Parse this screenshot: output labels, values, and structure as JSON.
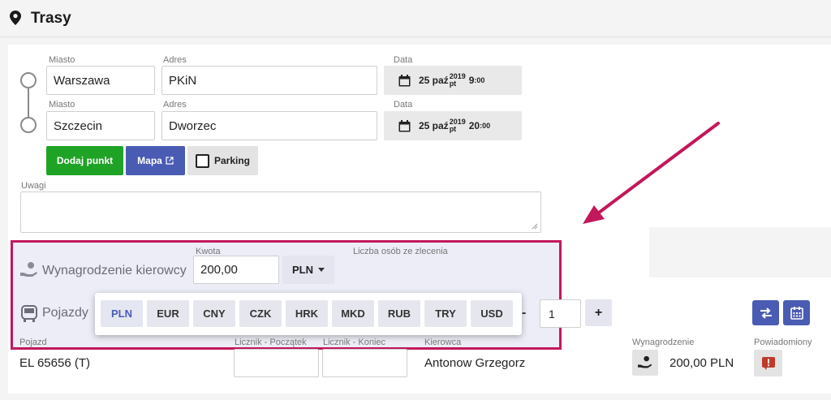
{
  "header": {
    "title": "Trasy"
  },
  "route": {
    "labels": {
      "city": "Miasto",
      "address": "Adres",
      "date": "Data"
    },
    "points": [
      {
        "city": "Warszawa",
        "address": "PKiN",
        "day": "25 paź",
        "year": "2019",
        "weekday": "pt",
        "hour": "9",
        "minutes": ":00"
      },
      {
        "city": "Szczecin",
        "address": "Dworzec",
        "day": "25 paź",
        "year": "2019",
        "weekday": "pt",
        "hour": "20",
        "minutes": ":00"
      }
    ],
    "buttons": {
      "add_point": "Dodaj punkt",
      "map": "Mapa",
      "parking": "Parking"
    }
  },
  "notes": {
    "label": "Uwagi"
  },
  "salary": {
    "label": "Wynagrodzenie kierowcy",
    "amount_label": "Kwota",
    "amount": "200,00",
    "currency": "PLN",
    "persons_label": "Liczba osób ze zlecenia"
  },
  "currency_options": [
    "PLN",
    "EUR",
    "CNY",
    "CZK",
    "HRK",
    "MKD",
    "RUB",
    "TRY",
    "USD"
  ],
  "vehicles": {
    "label": "Pojazdy",
    "count": "1",
    "plus": "+",
    "minus": "-"
  },
  "table": {
    "headers": {
      "vehicle": "Pojazd",
      "counter_start": "Licznik - Początek",
      "counter_end": "Licznik - Koniec",
      "driver": "Kierowca",
      "salary": "Wynagrodzenie",
      "notified": "Powiadomiony"
    },
    "row": {
      "vehicle": "EL 65656 (T)",
      "driver": "Antonow Grzegorz",
      "salary": "200,00 PLN"
    }
  },
  "colors": {
    "highlight": "#c2185b",
    "green": "#1fa326",
    "blue": "#4a5bb3",
    "alert": "#c0392b"
  }
}
